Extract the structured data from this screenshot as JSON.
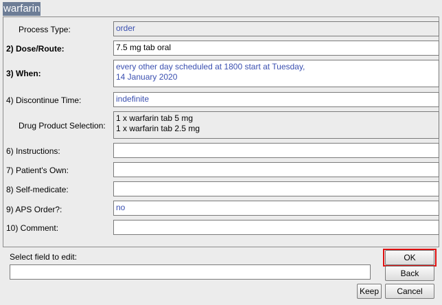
{
  "window": {
    "title": "warfarin"
  },
  "fields": [
    {
      "label": "Process Type:",
      "value": "order",
      "bold": false
    },
    {
      "label": "2) Dose/Route:",
      "value": "7.5 mg tab oral",
      "bold": true
    },
    {
      "label": "3) When:",
      "value": "every other day scheduled at 1800 start at Tuesday,\n     14 January 2020",
      "bold": true
    },
    {
      "label": "4)  Discontinue Time:",
      "value": "indefinite",
      "bold": false
    },
    {
      "label": "Drug Product Selection:",
      "value": "1 x warfarin tab 5 mg\n1 x warfarin tab 2.5 mg",
      "bold": false
    },
    {
      "label": "6) Instructions:",
      "value": "",
      "bold": false
    },
    {
      "label": "7) Patient's Own:",
      "value": "",
      "bold": false
    },
    {
      "label": "8) Self-medicate:",
      "value": "",
      "bold": false
    },
    {
      "label": "9) APS Order?:",
      "value": "no",
      "bold": false
    },
    {
      "label": "10)  Comment:",
      "value": "",
      "bold": false
    }
  ],
  "edit": {
    "label": "Select field to edit:",
    "value": ""
  },
  "buttons": {
    "ok": "OK",
    "back": "Back",
    "keep": "Keep",
    "cancel": "Cancel"
  }
}
